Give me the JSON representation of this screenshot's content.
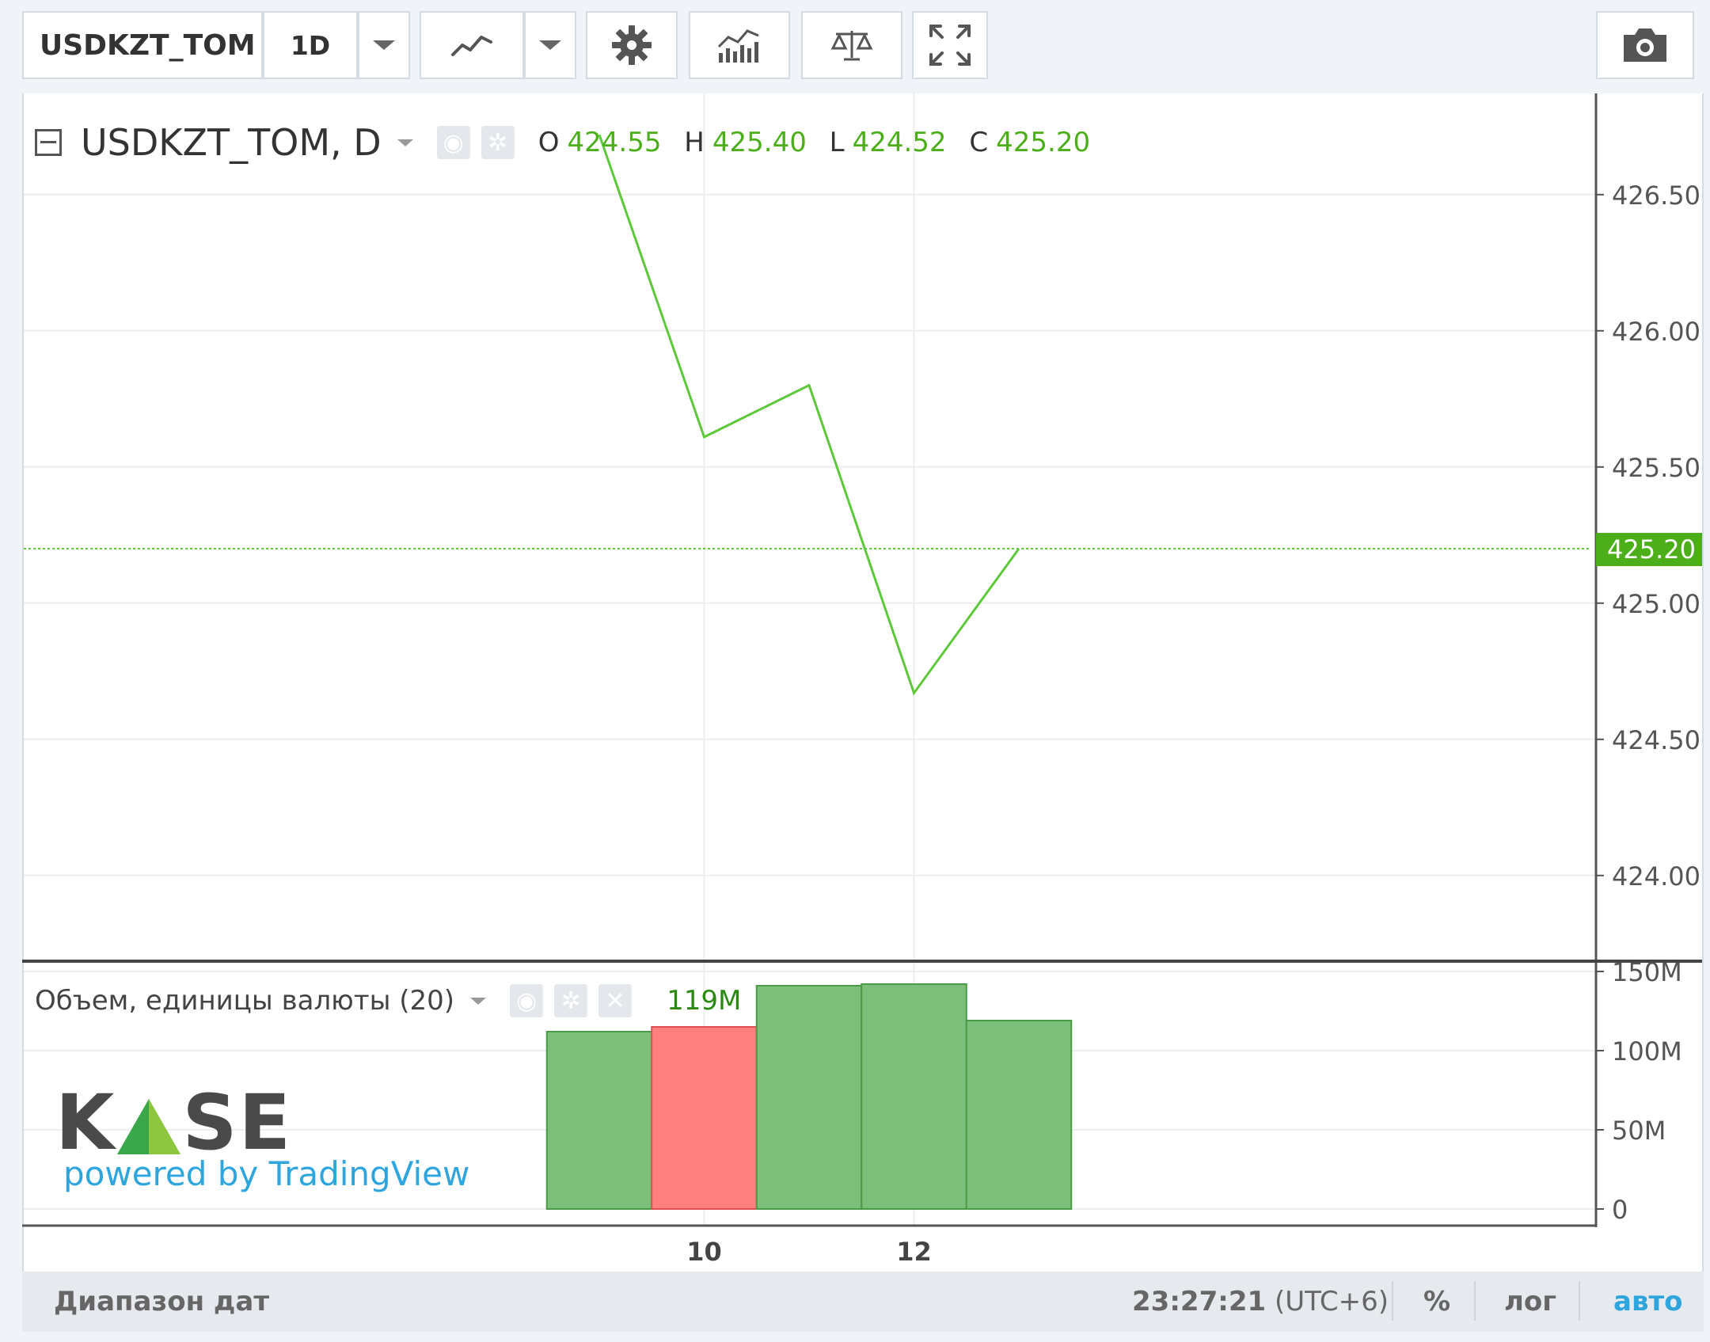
{
  "toolbar": {
    "symbol": "USDKZT_TOM",
    "interval": "1D",
    "icons": {
      "interval_dropdown": "chevron-down-icon",
      "chart_type": "line-chart-icon",
      "chart_type_dropdown": "chevron-down-icon",
      "settings": "gear-icon",
      "indicators": "indicators-icon",
      "compare": "scales-icon",
      "fullscreen": "fullscreen-icon",
      "snapshot": "camera-icon"
    }
  },
  "legend": {
    "title": "USDKZT_TOM, D",
    "ohlc": {
      "o_label": "O",
      "o": "424.55",
      "h_label": "H",
      "h": "425.40",
      "l_label": "L",
      "l": "424.52",
      "c_label": "C",
      "c": "425.20"
    }
  },
  "volume_legend": {
    "title": "Объем, единицы валюты (20)",
    "value": "119M"
  },
  "logo": {
    "text_k": "K",
    "text_se": "SE",
    "powered_by": "powered by TradingView"
  },
  "statusbar": {
    "date_range": "Диапазон дат",
    "time": "23:27:21",
    "timezone": "(UTC+6)",
    "percent": "%",
    "log": "лог",
    "auto": "авто"
  },
  "colors": {
    "line": "#5dc93a",
    "up_volume": "#7cbf7a",
    "down_volume": "#ff7f7f",
    "accent": "#2ea5dc",
    "last_price": "#4caf1a"
  },
  "chart_data": [
    {
      "type": "line",
      "x": [
        "9",
        "10",
        "11",
        "12",
        "13"
      ],
      "values": [
        426.72,
        425.61,
        425.8,
        424.67,
        425.2
      ],
      "ylim": [
        423.6,
        426.85
      ],
      "y_ticks": [
        "426.50",
        "426.00",
        "425.50",
        "425.00",
        "424.50",
        "424.00"
      ],
      "y_tick_values": [
        426.5,
        426.0,
        425.5,
        425.0,
        424.5,
        424.0
      ],
      "last_price": 425.2,
      "last_price_label": "425.20",
      "x_tick_labels": [
        {
          "x": "10",
          "label": "10"
        },
        {
          "x": "12",
          "label": "12"
        }
      ],
      "grid": true
    },
    {
      "type": "bar",
      "x": [
        "9",
        "10",
        "11",
        "12",
        "13"
      ],
      "values": [
        112,
        115,
        141,
        142,
        119
      ],
      "directions": [
        "up",
        "down",
        "up",
        "up",
        "up"
      ],
      "ylim": [
        0,
        150
      ],
      "y_ticks": [
        "150M",
        "100M",
        "50M",
        "0"
      ],
      "y_tick_values": [
        150,
        100,
        50,
        0
      ]
    }
  ]
}
